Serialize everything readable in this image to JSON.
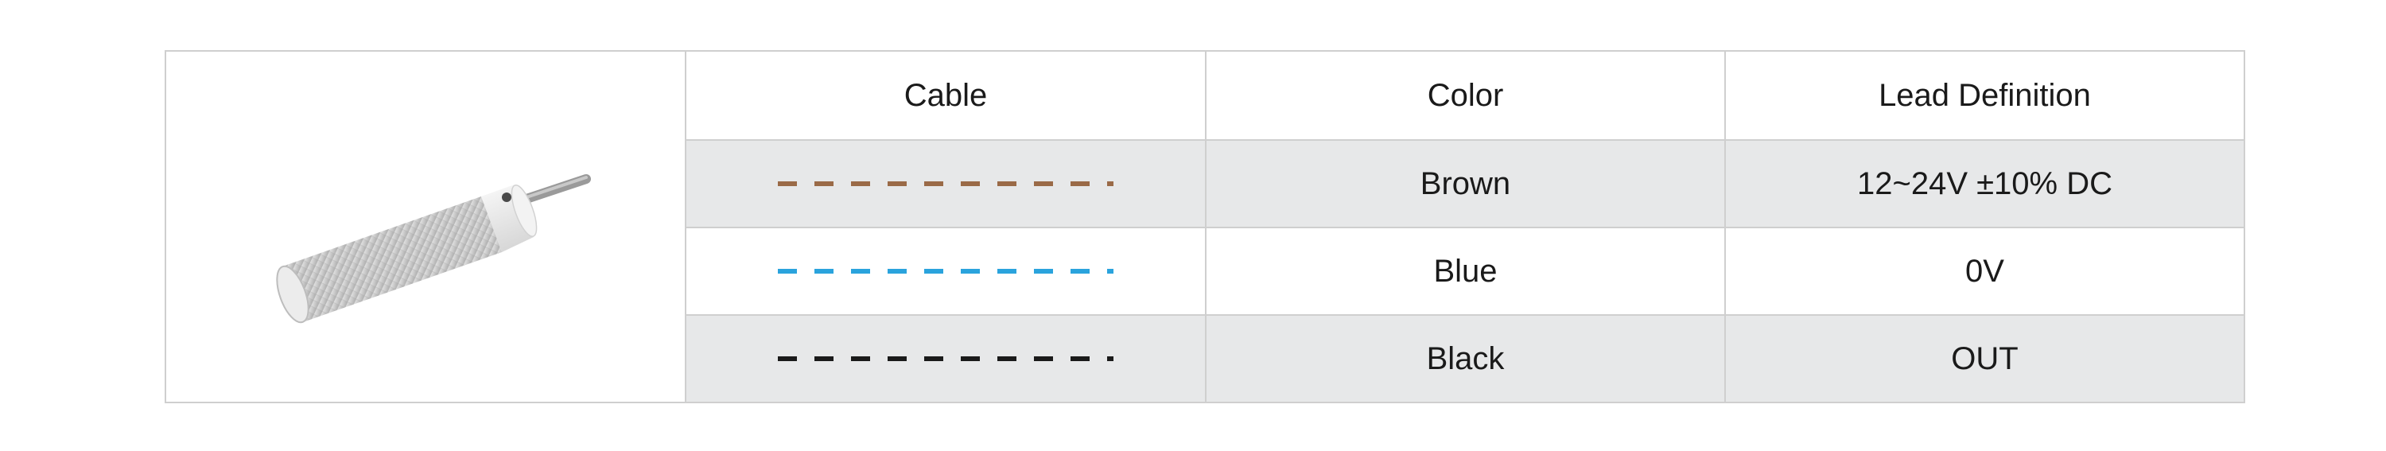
{
  "headers": {
    "cable": "Cable",
    "color": "Color",
    "lead": "Lead Definition"
  },
  "product_image": {
    "icon": "proximity-sensor-icon"
  },
  "rows": [
    {
      "line_color": "#9a6a47",
      "color": "Brown",
      "lead": "12~24V ±10% DC"
    },
    {
      "line_color": "#2aa3dd",
      "color": "Blue",
      "lead": "0V"
    },
    {
      "line_color": "#1a1a1a",
      "color": "Black",
      "lead": "OUT"
    }
  ]
}
